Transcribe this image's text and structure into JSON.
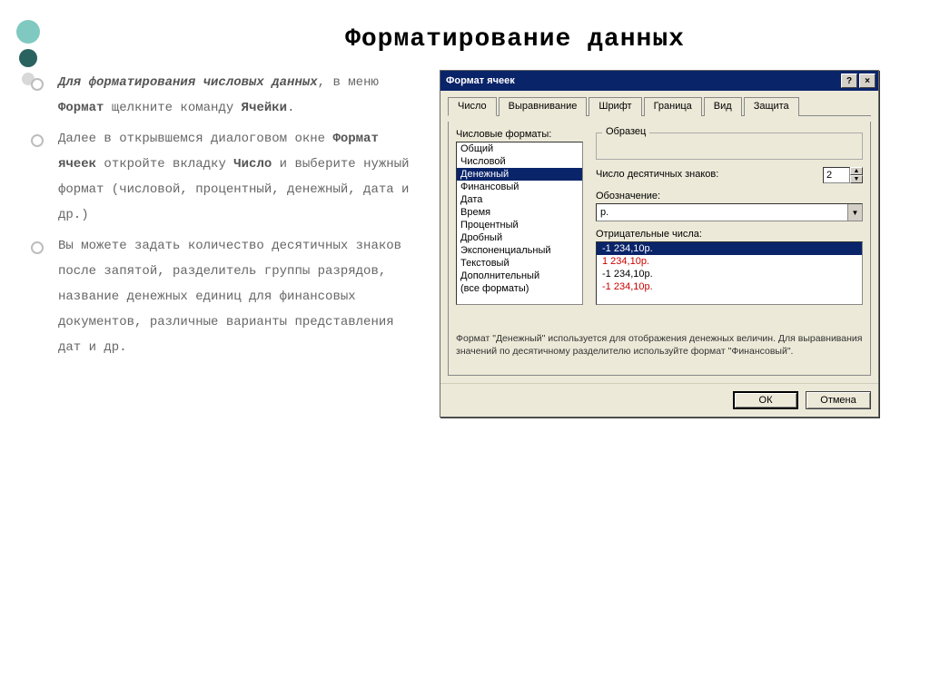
{
  "title": "Форматирование данных",
  "bullets": {
    "b1_pre": "Для форматирования числовых данных",
    "b1_mid": ", в меню ",
    "b1_bold2": "Формат",
    "b1_mid2": " щелкните команду ",
    "b1_bold3": "Ячейки",
    "b1_end": ".",
    "b2_pre": "Далее в открывшемся диалоговом окне ",
    "b2_bold1": "Формат ячеек",
    "b2_mid": " откройте вкладку ",
    "b2_bold2": "Число",
    "b2_end": " и выберите нужный формат (числовой, процентный, денежный, дата и др.)",
    "b3": "Вы можете задать количество десятичных знаков после запятой, разделитель группы разрядов, название денежных единиц для финансовых документов, различные варианты представления дат и др."
  },
  "dialog": {
    "title": "Формат ячеек",
    "help": "?",
    "close": "×",
    "tabs": [
      "Число",
      "Выравнивание",
      "Шрифт",
      "Граница",
      "Вид",
      "Защита"
    ],
    "formatsLabel": "Числовые форматы:",
    "formats": [
      "Общий",
      "Числовой",
      "Денежный",
      "Финансовый",
      "Дата",
      "Время",
      "Процентный",
      "Дробный",
      "Экспоненциальный",
      "Текстовый",
      "Дополнительный",
      "(все форматы)"
    ],
    "formatsSelected": 2,
    "sampleLabel": "Образец",
    "decimalLabel": "Число десятичных знаков:",
    "decimalValue": "2",
    "symbolLabel": "Обозначение:",
    "symbolValue": "р.",
    "negLabel": "Отрицательные числа:",
    "negatives": [
      {
        "text": "-1 234,10р.",
        "red": false,
        "sel": true
      },
      {
        "text": "1 234,10р.",
        "red": true,
        "sel": false
      },
      {
        "text": "-1 234,10р.",
        "red": false,
        "sel": false
      },
      {
        "text": "-1 234,10р.",
        "red": true,
        "sel": false
      }
    ],
    "desc": "Формат \"Денежный\" используется для отображения денежных величин. Для выравнивания значений по десятичному разделителю используйте формат \"Финансовый\".",
    "ok": "ОК",
    "cancel": "Отмена"
  }
}
